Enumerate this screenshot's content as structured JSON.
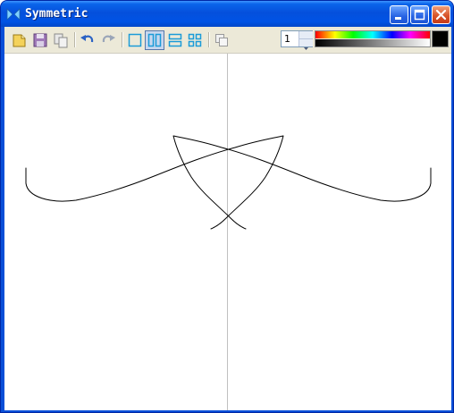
{
  "window": {
    "title": "Symmetric"
  },
  "toolbar": {
    "buttons": [
      {
        "name": "new-button",
        "icon": "new-document-icon"
      },
      {
        "name": "save-button",
        "icon": "save-icon"
      },
      {
        "name": "copy-button",
        "icon": "copy-icon"
      },
      {
        "name": "undo-button",
        "icon": "undo-icon"
      },
      {
        "name": "redo-button",
        "icon": "redo-icon"
      },
      {
        "name": "layout-single-button",
        "icon": "single-pane-icon"
      },
      {
        "name": "layout-vertical-split-button",
        "icon": "vertical-split-icon",
        "pressed": true
      },
      {
        "name": "layout-horizontal-split-button",
        "icon": "horizontal-split-icon"
      },
      {
        "name": "layout-quad-button",
        "icon": "quad-split-icon"
      },
      {
        "name": "duplicate-button",
        "icon": "duplicate-icon"
      }
    ],
    "brush_size": "1"
  },
  "colors": {
    "selected": "#000000",
    "accent": "#1a66c9",
    "stroke": "#000000",
    "mirror_axis": "#c0c0c0"
  }
}
